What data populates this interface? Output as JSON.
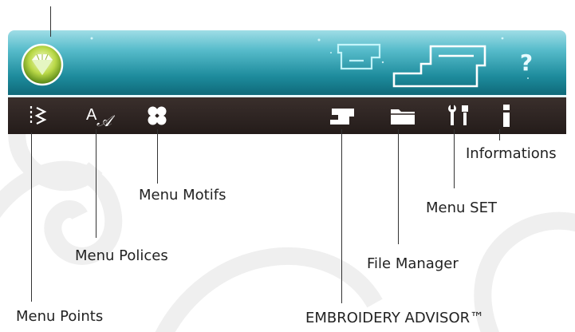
{
  "top_bar": {
    "logo_icon": "diamond-logo-icon",
    "help_label": "?",
    "sewing_mode_icon": "sewing-machine-mode-icon",
    "embroidery_mode_icon": "embroidery-machine-mode-icon"
  },
  "toolbar": {
    "items": [
      {
        "name": "Menu Points",
        "icon": "stitch-zigzag-icon"
      },
      {
        "name": "Menu Polices",
        "icon": "font-icon"
      },
      {
        "name": "Menu Motifs",
        "icon": "motif-flower-icon"
      },
      {
        "name": "EMBROIDERY ADVISOR™",
        "icon": "sewing-machine-icon"
      },
      {
        "name": "File Manager",
        "icon": "folder-icon"
      },
      {
        "name": "Menu SET",
        "icon": "tools-icon"
      },
      {
        "name": "Informations",
        "icon": "info-icon"
      }
    ]
  },
  "callouts": {
    "points": "Menu Points",
    "polices": "Menu Polices",
    "motifs": "Menu Motifs",
    "advisor": "EMBROIDERY ADVISOR™",
    "file_manager": "File Manager",
    "set": "Menu SET",
    "informations": "Informations"
  },
  "colors": {
    "top_bar": "#1e8c9d",
    "toolbar": "#2a211f",
    "icon": "#ffffff"
  }
}
